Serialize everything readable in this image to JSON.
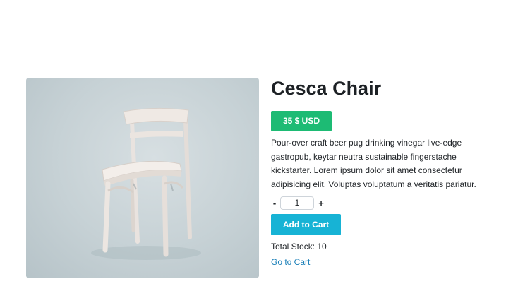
{
  "product": {
    "title": "Cesca Chair",
    "price": "35 $ USD",
    "description": "Pour-over craft beer pug drinking vinegar live-edge gastropub, keytar neutra sustainable fingerstache kickstarter. Lorem ipsum dolor sit amet consectetur adipisicing elit. Voluptas voluptatum a veritatis pariatur.",
    "image_alt": "White wooden chair"
  },
  "quantity": {
    "decrement_label": "-",
    "value": "1",
    "increment_label": "+"
  },
  "actions": {
    "add_to_cart_label": "Add to Cart",
    "go_to_cart_label": "Go to Cart"
  },
  "stock": {
    "text": "Total Stock: 10"
  },
  "colors": {
    "price_badge": "#1dbb74",
    "add_to_cart": "#17b3d5",
    "link": "#1a7fb8"
  }
}
